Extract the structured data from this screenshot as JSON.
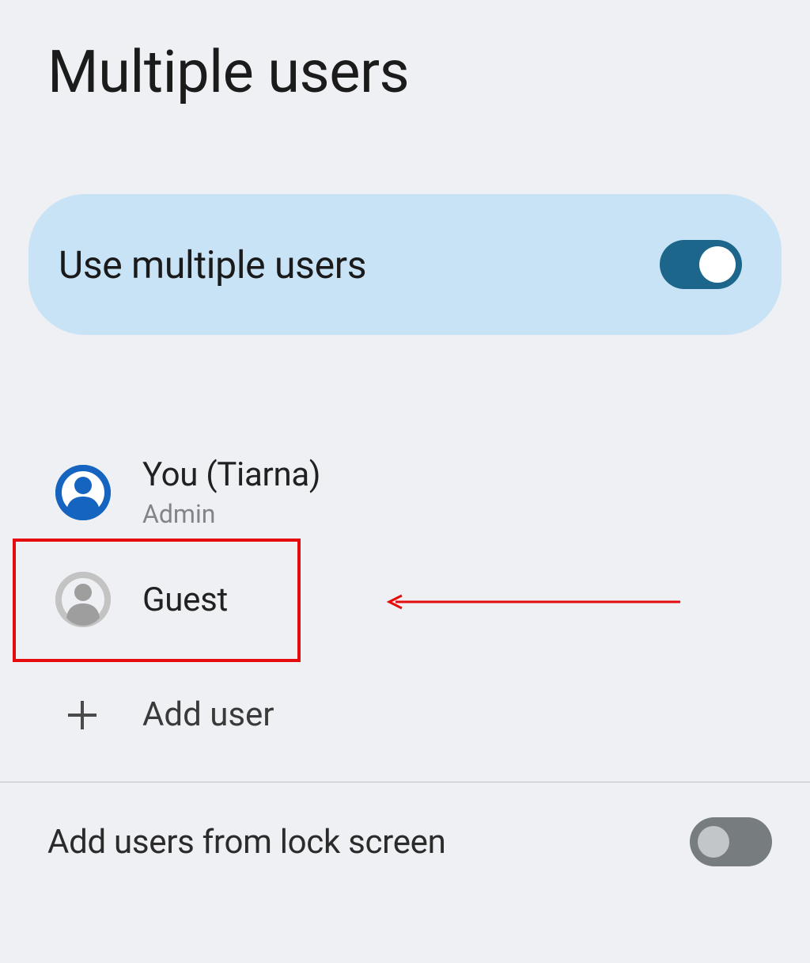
{
  "title": "Multiple users",
  "toggle": {
    "label": "Use multiple users",
    "state": "on"
  },
  "users": [
    {
      "title": "You (Tiarna)",
      "subtitle": "Admin",
      "avatar": "primary"
    },
    {
      "title": "Guest",
      "subtitle": "",
      "avatar": "guest"
    }
  ],
  "add_user": {
    "label": "Add user"
  },
  "lock_screen": {
    "label": "Add users from lock screen",
    "state": "off"
  },
  "annotations": {
    "highlight_target": "guest-user-row",
    "arrow_color": "#e40c0c"
  }
}
